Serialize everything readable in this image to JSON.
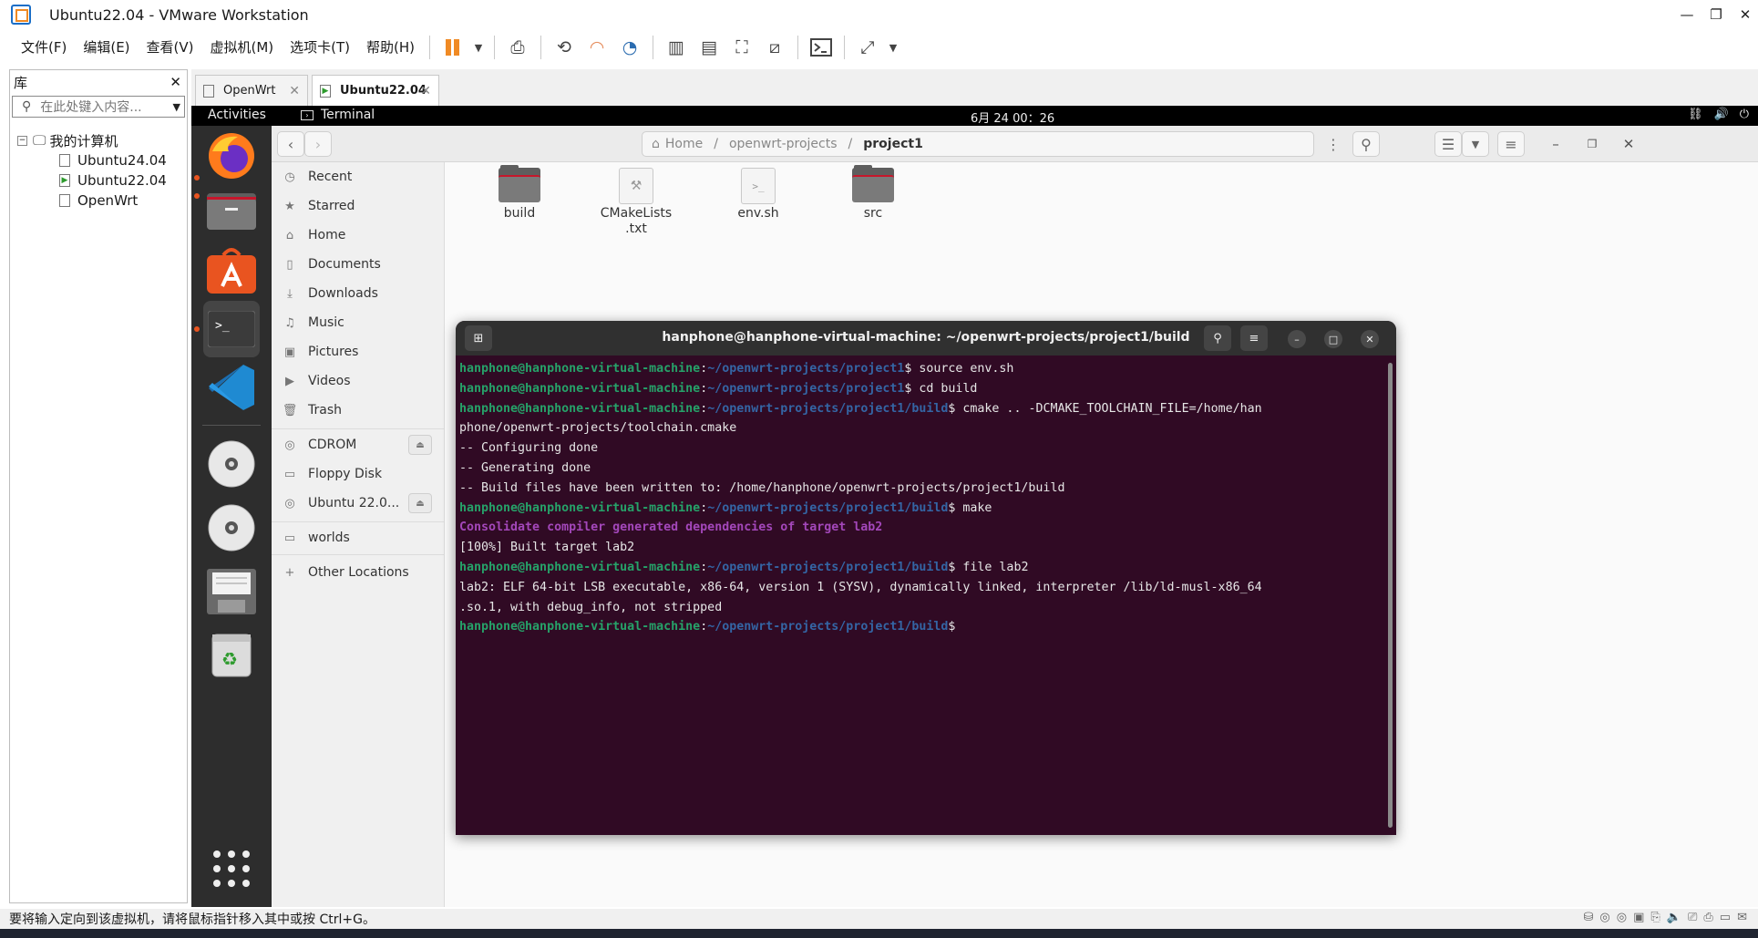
{
  "window": {
    "title": "Ubuntu22.04 - VMware Workstation"
  },
  "menubar": {
    "items": [
      "文件(F)",
      "编辑(E)",
      "查看(V)",
      "虚拟机(M)",
      "选项卡(T)",
      "帮助(H)"
    ]
  },
  "library": {
    "title": "库",
    "search_placeholder": "在此处键入内容...",
    "root": "我的计算机",
    "vms": [
      "Ubuntu24.04",
      "Ubuntu22.04",
      "OpenWrt"
    ]
  },
  "tabs": [
    {
      "label": "OpenWrt"
    },
    {
      "label": "Ubuntu22.04"
    }
  ],
  "guest": {
    "activities": "Activities",
    "app_name": "Terminal",
    "clock": "6月 24 00：26"
  },
  "files": {
    "path": [
      "Home",
      "openwrt-projects",
      "project1"
    ],
    "sidebar": [
      "Recent",
      "Starred",
      "Home",
      "Documents",
      "Downloads",
      "Music",
      "Pictures",
      "Videos",
      "Trash"
    ],
    "devices": [
      "CDROM",
      "Floppy Disk",
      "Ubuntu 22.0..."
    ],
    "bookmarks": [
      "worlds"
    ],
    "other": "Other Locations",
    "items": [
      {
        "name": "build",
        "type": "folder"
      },
      {
        "name": "CMakeLists\n.txt",
        "type": "file"
      },
      {
        "name": "env.sh",
        "type": "script"
      },
      {
        "name": "src",
        "type": "folder"
      }
    ]
  },
  "terminal": {
    "title": "hanphone@hanphone-virtual-machine: ~/openwrt-projects/project1/build",
    "user_host": "hanphone@hanphone-virtual-machine",
    "lines": [
      {
        "kind": "prompt",
        "path": "~/openwrt-projects/project1",
        "cmd": " source env.sh"
      },
      {
        "kind": "prompt",
        "path": "~/openwrt-projects/project1",
        "cmd": " cd build"
      },
      {
        "kind": "prompt",
        "path": "~/openwrt-projects/project1/build",
        "cmd": " cmake .. -DCMAKE_TOOLCHAIN_FILE=/home/han"
      },
      {
        "kind": "out",
        "text": "phone/openwrt-projects/toolchain.cmake"
      },
      {
        "kind": "out",
        "text": "-- Configuring done"
      },
      {
        "kind": "out",
        "text": "-- Generating done"
      },
      {
        "kind": "out",
        "text": "-- Build files have been written to: /home/hanphone/openwrt-projects/project1/build"
      },
      {
        "kind": "prompt",
        "path": "~/openwrt-projects/project1/build",
        "cmd": " make"
      },
      {
        "kind": "magenta",
        "text": "Consolidate compiler generated dependencies of target lab2"
      },
      {
        "kind": "out",
        "text": "[100%] Built target lab2"
      },
      {
        "kind": "prompt",
        "path": "~/openwrt-projects/project1/build",
        "cmd": " file lab2"
      },
      {
        "kind": "out",
        "text": "lab2: ELF 64-bit LSB executable, x86-64, version 1 (SYSV), dynamically linked, interpreter /lib/ld-musl-x86_64"
      },
      {
        "kind": "out",
        "text": ".so.1, with debug_info, not stripped"
      },
      {
        "kind": "prompt",
        "path": "~/openwrt-projects/project1/build",
        "cmd": " "
      }
    ]
  },
  "statusbar": {
    "text": "要将输入定向到该虚拟机，请将鼠标指针移入其中或按 Ctrl+G。"
  },
  "colors": {
    "terminal_bg": "#300a24",
    "prompt_user": "#26a269",
    "prompt_path": "#3465a4",
    "ubuntu_orange": "#e95420"
  }
}
